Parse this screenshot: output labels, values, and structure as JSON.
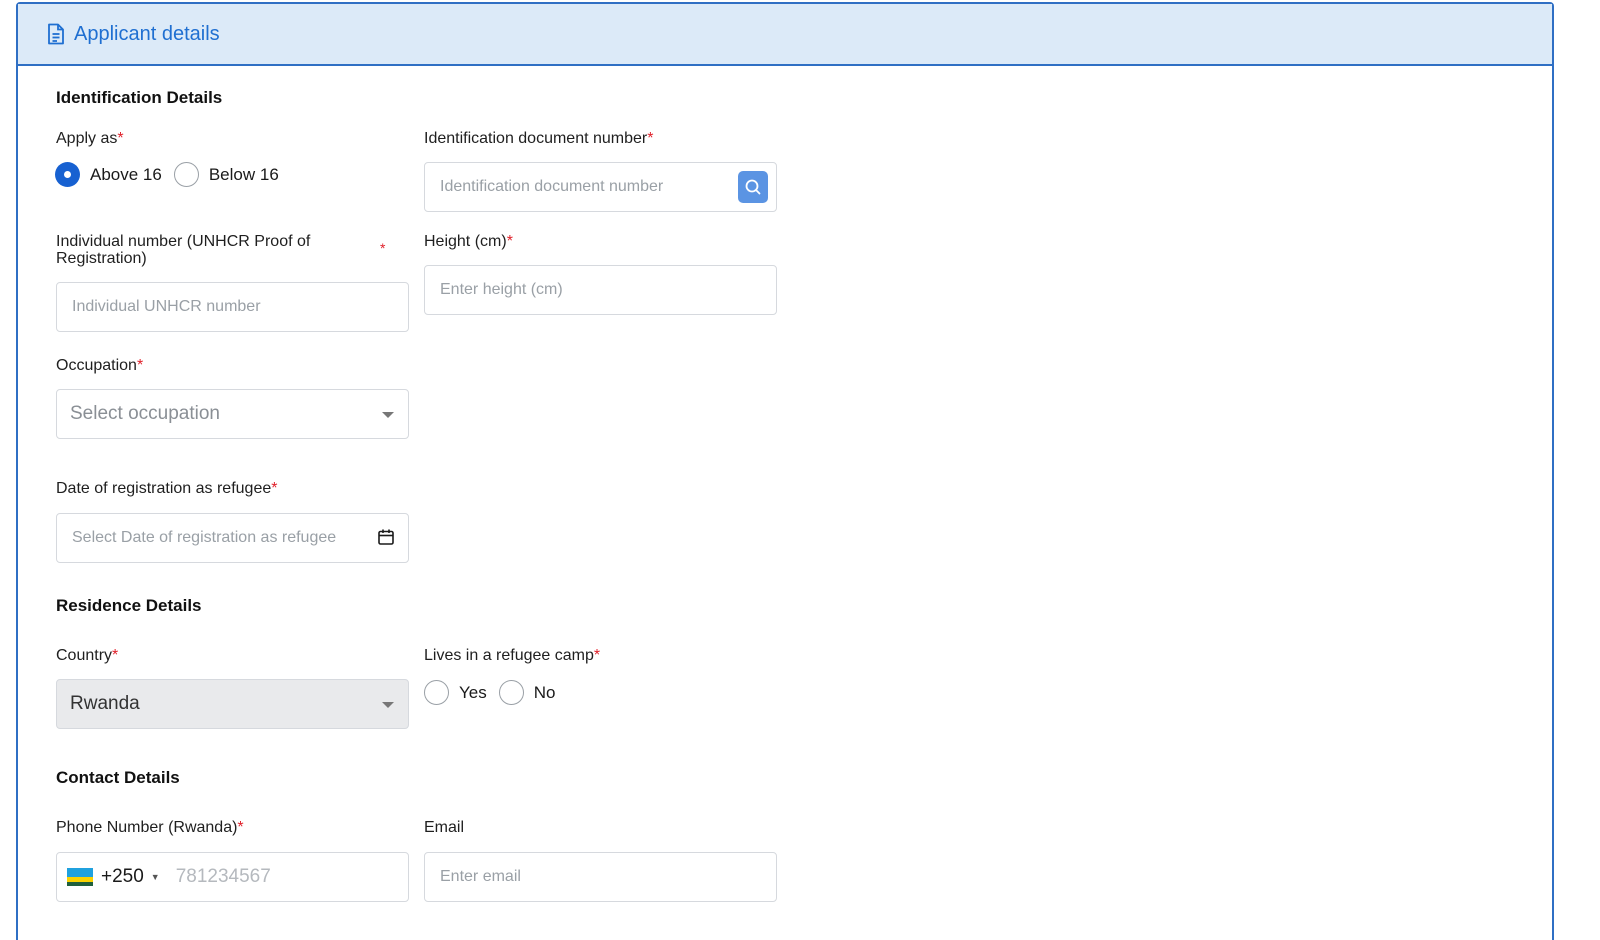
{
  "header": {
    "title": "Applicant details",
    "icon": "document-icon"
  },
  "identification": {
    "section_title": "Identification Details",
    "apply_as": {
      "label": "Apply as",
      "required": "*",
      "options": [
        "Above 16",
        "Below 16"
      ],
      "selected": "Above 16"
    },
    "id_doc_number": {
      "label": "Identification document number",
      "required": "*",
      "placeholder": "Identification document number"
    },
    "unhcr_number": {
      "label": "Individual number (UNHCR Proof of Registration)",
      "required": "*",
      "placeholder": "Individual UNHCR number"
    },
    "height": {
      "label": "Height (cm)",
      "required": "*",
      "placeholder": "Enter height (cm)"
    },
    "occupation": {
      "label": "Occupation",
      "required": "*",
      "placeholder": "Select occupation"
    },
    "registration_date": {
      "label": "Date of registration as refugee",
      "required": "*",
      "placeholder": "Select Date of registration as refugee"
    }
  },
  "residence": {
    "section_title": "Residence Details",
    "country": {
      "label": "Country",
      "required": "*",
      "value": "Rwanda"
    },
    "refugee_camp": {
      "label": "Lives in a refugee camp",
      "required": "*",
      "options": [
        "Yes",
        "No"
      ]
    }
  },
  "contact": {
    "section_title": "Contact Details",
    "phone": {
      "label": "Phone Number (Rwanda)",
      "required": "*",
      "country_code": "+250",
      "placeholder": "781234567"
    },
    "email": {
      "label": "Email",
      "placeholder": "Enter email"
    }
  },
  "colors": {
    "accent": "#1761d1",
    "header_bg": "#dceaf8",
    "border": "#2f6fc4",
    "required": "#e0202a"
  }
}
